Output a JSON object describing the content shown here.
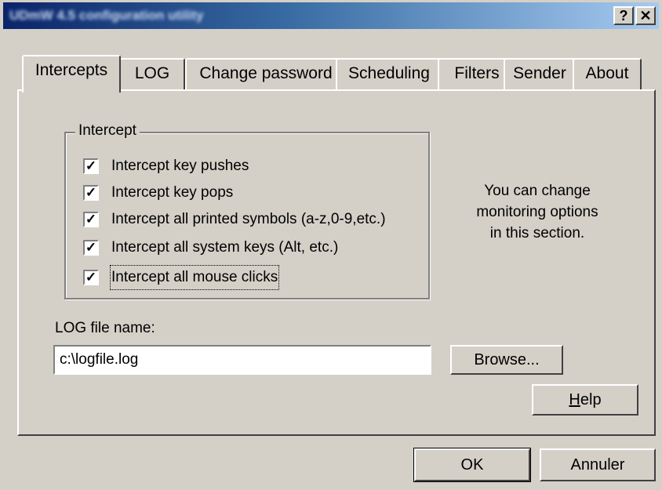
{
  "window": {
    "title": "UDmW 4.5 configuration utility",
    "help_btn": "?",
    "close_btn": "✕"
  },
  "tabs": [
    {
      "label": "Intercepts",
      "active": true
    },
    {
      "label": "LOG",
      "active": false
    },
    {
      "label": "Change password",
      "active": false
    },
    {
      "label": "Scheduling",
      "active": false
    },
    {
      "label": "Filters",
      "active": false
    },
    {
      "label": "Sender",
      "active": false
    },
    {
      "label": "About",
      "active": false
    }
  ],
  "intercept_group": {
    "label": "Intercept",
    "items": [
      {
        "label": "Intercept key pushes",
        "checked": true
      },
      {
        "label": "Intercept key pops",
        "checked": true
      },
      {
        "label": "Intercept all printed symbols (a-z,0-9,etc.)",
        "checked": true
      },
      {
        "label": "Intercept all system keys (Alt, etc.)",
        "checked": true
      },
      {
        "label": "Intercept all mouse clicks",
        "checked": true
      }
    ]
  },
  "info_text": [
    "You can change",
    "monitoring options",
    "in this section."
  ],
  "log_file": {
    "label": "LOG file name:",
    "value": "c:\\logfile.log"
  },
  "buttons": {
    "browse": "Browse...",
    "help_hotkey": "H",
    "help_rest": "elp",
    "ok": "OK",
    "cancel": "Annuler"
  }
}
